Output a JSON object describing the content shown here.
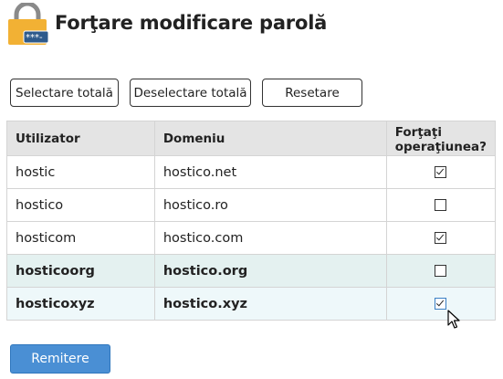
{
  "page": {
    "title": "Forţare modificare parolă"
  },
  "toolbar": {
    "select_all": "Selectare totală",
    "deselect_all": "Deselectare totală",
    "reset": "Resetare"
  },
  "table": {
    "headers": {
      "user": "Utilizator",
      "domain": "Domeniu",
      "force_line1": "Forţaţi",
      "force_line2": "operaţiunea?"
    },
    "rows": [
      {
        "user": "hostic",
        "domain": "hostico.net",
        "checked": true
      },
      {
        "user": "hostico",
        "domain": "hostico.ro",
        "checked": false
      },
      {
        "user": "hosticom",
        "domain": "hostico.com",
        "checked": true
      },
      {
        "user": "hosticoorg",
        "domain": "hostico.org",
        "checked": false
      },
      {
        "user": "hosticoxyz",
        "domain": "hostico.xyz",
        "checked": true
      }
    ]
  },
  "submit": {
    "label": "Remitere"
  },
  "colors": {
    "accent": "#4a8fd4",
    "lock_gold": "#f2b134",
    "row_highlight": "#e4f1f0"
  },
  "icons": {
    "header": "padlock-password-icon",
    "pointer": "mouse-cursor-icon"
  }
}
